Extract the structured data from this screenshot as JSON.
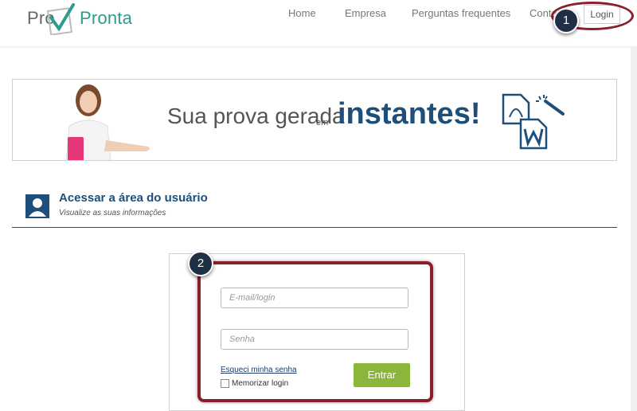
{
  "header": {
    "logo": {
      "part1": "Pro",
      "part2": "Pronta"
    },
    "nav": [
      "Home",
      "Empresa",
      "Perguntas frequentes",
      "Contato"
    ],
    "login_label": "Login"
  },
  "markers": {
    "one": "1",
    "two": "2"
  },
  "banner": {
    "text_main": "Sua prova gerada",
    "text_small": "em",
    "text_big": "instantes!"
  },
  "section": {
    "title": "Acessar a área do usuário",
    "subtitle": "Visualize as suas informações"
  },
  "form": {
    "email_placeholder": "E-mail/login",
    "password_placeholder": "Senha",
    "forgot_label": "Esqueci minha senha",
    "remember_label": "Memorizar login",
    "submit_label": "Entrar"
  },
  "colors": {
    "accent": "#1d4f7a",
    "brand_green": "#2a9d8f",
    "submit_green": "#8bb63a",
    "highlight": "#8b1e2a"
  }
}
